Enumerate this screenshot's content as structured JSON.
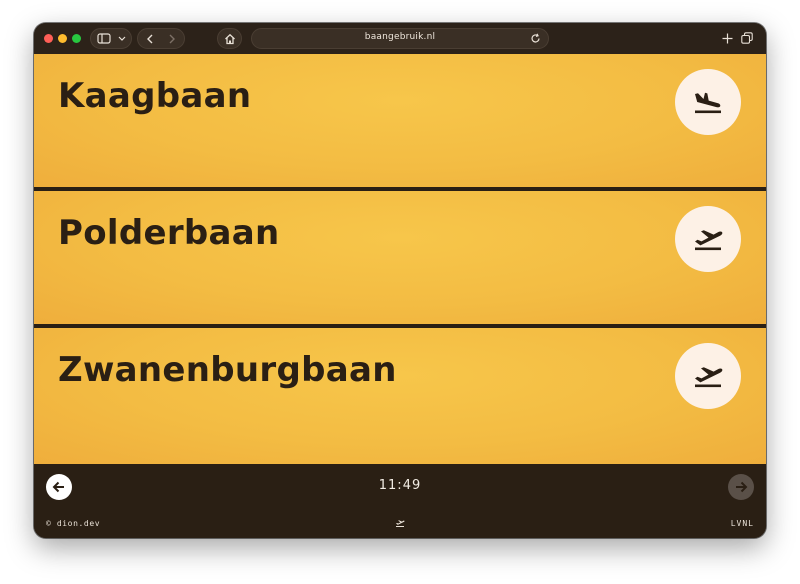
{
  "browser": {
    "url": "baangebruik.nl"
  },
  "runways": [
    {
      "name": "Kaagbaan",
      "mode": "landing",
      "icon": "plane-landing-icon"
    },
    {
      "name": "Polderbaan",
      "mode": "takeoff",
      "icon": "plane-takeoff-icon"
    },
    {
      "name": "Zwanenburgbaan",
      "mode": "takeoff",
      "icon": "plane-takeoff-icon"
    }
  ],
  "footer": {
    "time": "11:49",
    "credit": "© dion.dev",
    "provider": "LVNL"
  },
  "colors": {
    "accent": "#f3bc43",
    "dark": "#2a1f14",
    "badge": "#fdf1e6"
  }
}
